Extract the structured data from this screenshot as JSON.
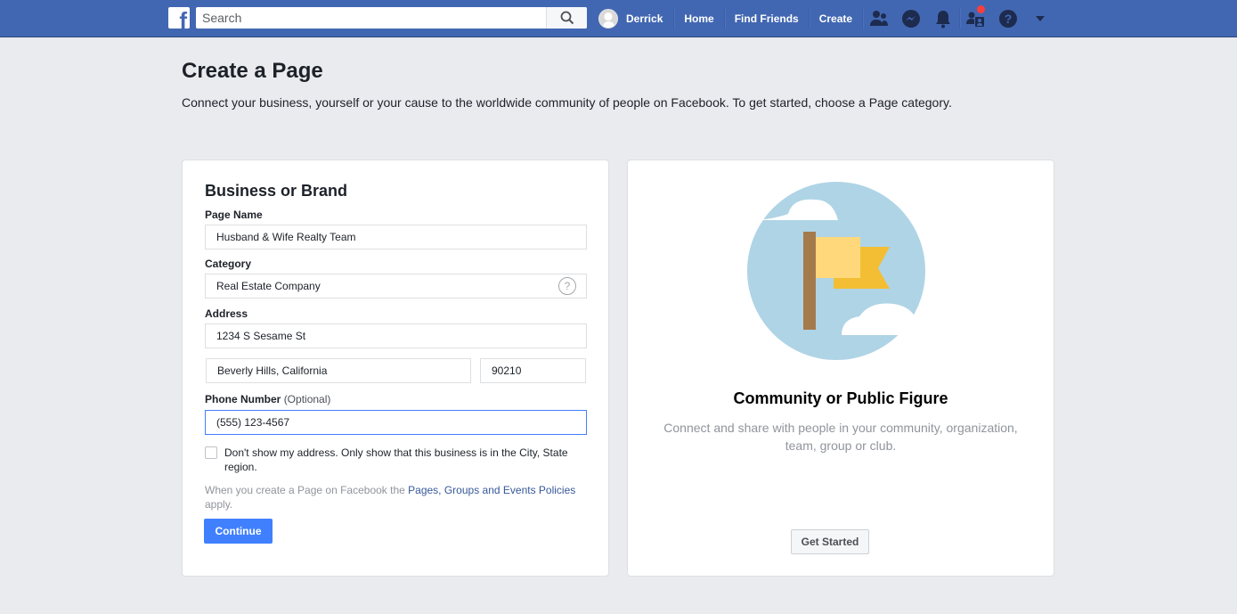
{
  "topbar": {
    "logo": "f",
    "search_placeholder": "Search",
    "user_name": "Derrick",
    "nav_links": [
      "Home",
      "Find Friends",
      "Create"
    ],
    "icons": [
      "friend-requests-icon",
      "messenger-icon",
      "notifications-icon",
      "groups-icon",
      "help-icon",
      "dropdown-caret-icon"
    ],
    "brand_color": "#4267b2",
    "badge_color": "#fa3e3e"
  },
  "header": {
    "title": "Create a Page",
    "subtitle": "Connect your business, yourself or your cause to the worldwide community of people on Facebook. To get started, choose a Page category."
  },
  "business_card": {
    "title": "Business or Brand",
    "page_name_label": "Page Name",
    "page_name_value": "Husband & Wife Realty Team",
    "category_label": "Category",
    "category_value": "Real Estate Company",
    "category_help": "?",
    "address_label": "Address",
    "street_value": "1234 S Sesame St",
    "city_state_value": "Beverly Hills, California",
    "zip_value": "90210",
    "phone_label": "Phone Number",
    "phone_optional": "(Optional)",
    "phone_value": "(555) 123-4567",
    "hide_address_checked": false,
    "hide_address_label": "Don't show my address. Only show that this business is in the City, State region.",
    "policy_prefix": "When you create a Page on Facebook the ",
    "policy_link": "Pages, Groups and Events Policies",
    "policy_suffix": " apply.",
    "continue_label": "Continue",
    "accent_color": "#4080ff"
  },
  "community_card": {
    "title": "Community or Public Figure",
    "description": "Connect and share with people in your community, organization, team, group or club.",
    "button_label": "Get Started"
  }
}
